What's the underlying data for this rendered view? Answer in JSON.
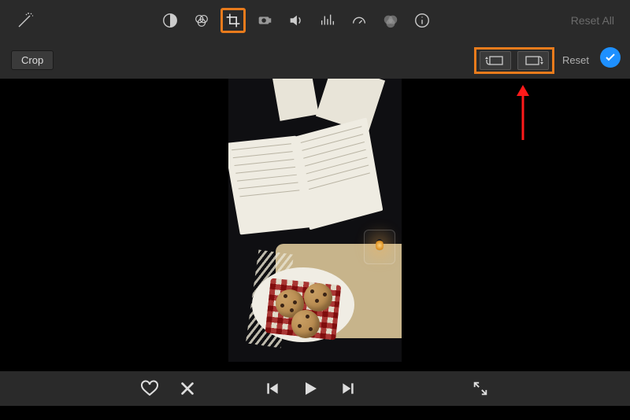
{
  "toolbar": {
    "reset_all_label": "Reset All"
  },
  "secondbar": {
    "crop_mode_label": "Crop",
    "reset_label": "Reset"
  },
  "highlight": {
    "color": "#e87b1c",
    "arrow_color": "#ff1a1a"
  }
}
